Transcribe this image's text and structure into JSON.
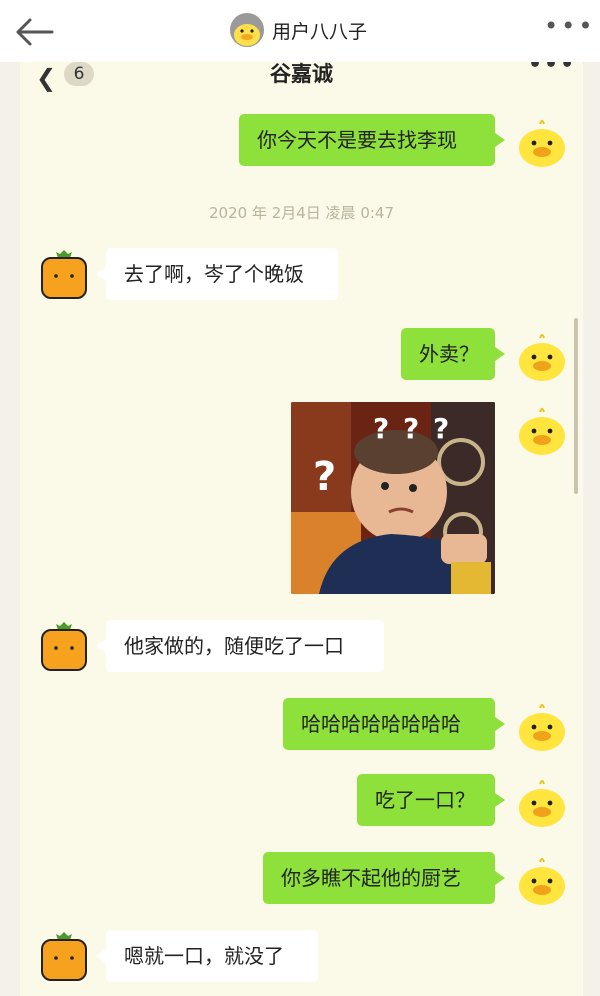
{
  "app_header": {
    "title": "用户八八子"
  },
  "chat": {
    "unread_count": "6",
    "title": "谷嘉诚",
    "timestamp": "2020 年 2月4日 凌晨 0:47"
  },
  "messages": [
    {
      "side": "right",
      "text": "你今天不是要去找李现"
    },
    {
      "side": "left",
      "text": "去了啊，岑了个晚饭"
    },
    {
      "side": "right",
      "text": "外卖？"
    },
    {
      "side": "right",
      "type": "sticker",
      "text": "? ? ?"
    },
    {
      "side": "left",
      "text": "他家做的，随便吃了一口"
    },
    {
      "side": "right",
      "text": "哈哈哈哈哈哈哈哈"
    },
    {
      "side": "right",
      "text": "吃了一口？"
    },
    {
      "side": "right",
      "text": "你多瞧不起他的厨艺"
    },
    {
      "side": "left",
      "text": "嗯就一口，就没了"
    }
  ],
  "icons": {
    "back": "arrow-left-icon",
    "more": "more-dots-icon",
    "self_avatar": "yellow-duck-avatar",
    "other_avatar": "orange-fruit-avatar"
  },
  "colors": {
    "sent_bubble": "#8ee13a",
    "received_bubble": "#ffffff",
    "background": "#fbf9e8"
  }
}
